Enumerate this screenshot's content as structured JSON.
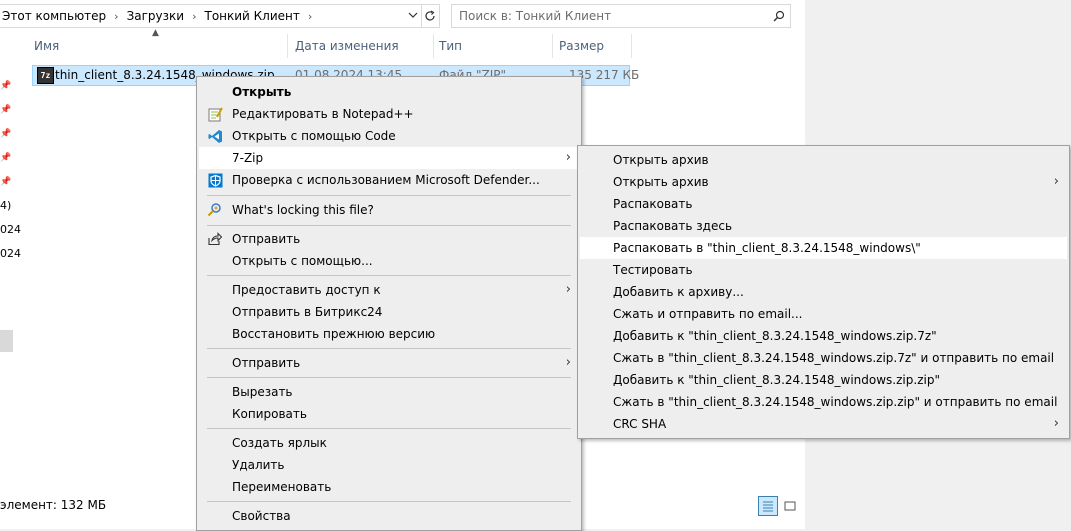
{
  "address": {
    "crumbs": [
      "Этот компьютер",
      "Загрузки",
      "Тонкий Клиент"
    ],
    "separator": "›",
    "search_placeholder": "Поиск в: Тонкий Клиент"
  },
  "columns": {
    "name": "Имя",
    "modified": "Дата изменения",
    "type": "Тип",
    "size": "Размер"
  },
  "file": {
    "icon_text": "7z",
    "name": "thin_client_8.3.24.1548_windows.zip",
    "modified": "01.08.2024 13:45",
    "type": "Файл \"ZIP\"",
    "size": "135 217 КБ"
  },
  "nav_fragments": [
    "4)",
    "024",
    "024"
  ],
  "status": {
    "text": "элемент: 132 МБ"
  },
  "context_menu": {
    "items": [
      {
        "label": "Открыть",
        "icon": ""
      },
      {
        "label": "Редактировать в Notepad++",
        "icon": "notepadpp-icon"
      },
      {
        "label": "Открыть с помощью Code",
        "icon": "vscode-icon"
      },
      {
        "label": "7-Zip",
        "icon": ""
      },
      {
        "label": "Проверка с использованием Microsoft Defender...",
        "icon": "defender-icon"
      },
      {
        "label": "What's locking this file?",
        "icon": "lock-search-icon"
      },
      {
        "label": "Отправить",
        "icon": "share-icon"
      },
      {
        "label": "Открыть с помощью...",
        "icon": ""
      },
      {
        "label": "Предоставить доступ к",
        "icon": ""
      },
      {
        "label": "Отправить в Битрикс24",
        "icon": ""
      },
      {
        "label": "Восстановить прежнюю версию",
        "icon": ""
      },
      {
        "label": "Отправить",
        "icon": ""
      },
      {
        "label": "Вырезать",
        "icon": ""
      },
      {
        "label": "Копировать",
        "icon": ""
      },
      {
        "label": "Создать ярлык",
        "icon": ""
      },
      {
        "label": "Удалить",
        "icon": ""
      },
      {
        "label": "Переименовать",
        "icon": ""
      },
      {
        "label": "Свойства",
        "icon": ""
      }
    ],
    "submenu_arrow": "›"
  },
  "zip_menu": {
    "items": [
      "Открыть архив",
      "Открыть архив",
      "Распаковать",
      "Распаковать здесь",
      "Распаковать в \"thin_client_8.3.24.1548_windows\\\"",
      "Тестировать",
      "Добавить к архиву...",
      "Сжать и отправить по email...",
      "Добавить к \"thin_client_8.3.24.1548_windows.zip.7z\"",
      "Сжать в \"thin_client_8.3.24.1548_windows.zip.7z\" и отправить по email",
      "Добавить к \"thin_client_8.3.24.1548_windows.zip.zip\"",
      "Сжать в \"thin_client_8.3.24.1548_windows.zip.zip\" и отправить по email",
      "CRC SHA"
    ]
  }
}
